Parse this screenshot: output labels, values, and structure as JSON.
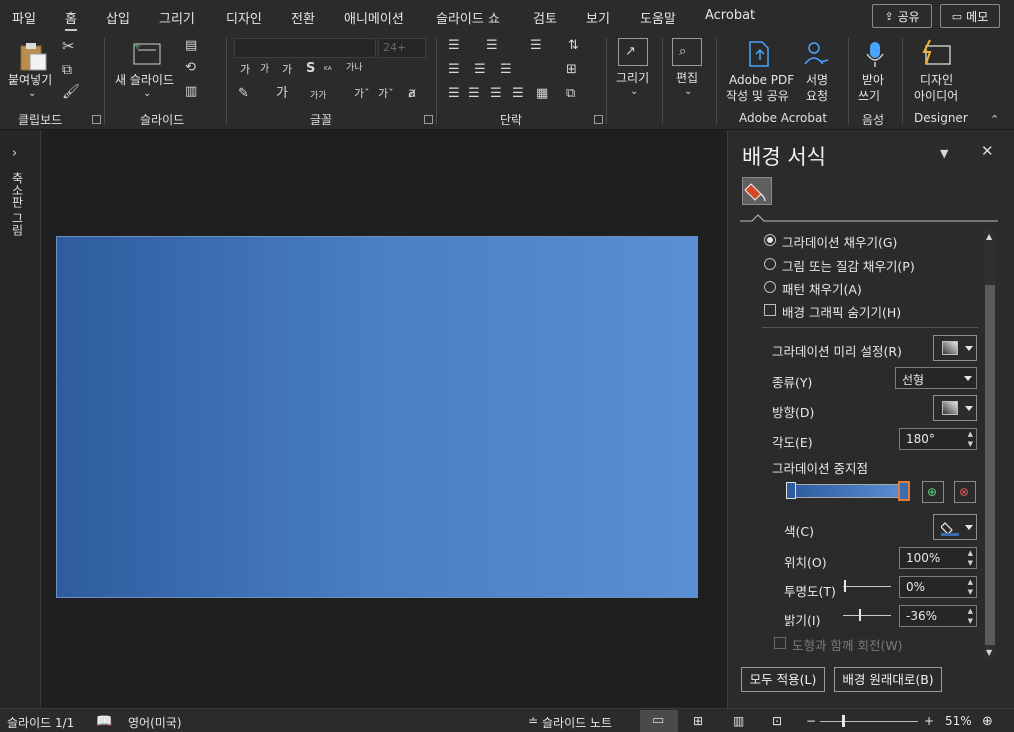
{
  "menu": {
    "tabs": [
      "파일",
      "홈",
      "삽입",
      "그리기",
      "디자인",
      "전환",
      "애니메이션",
      "슬라이드 쇼",
      "검토",
      "보기",
      "도움말",
      "Acrobat"
    ],
    "active_tab": "홈",
    "share_label": "공유",
    "memo_label": "메모"
  },
  "ribbon": {
    "clipboard": {
      "paste_label": "붙여넣기",
      "group_label": "클립보드"
    },
    "slides": {
      "new_slide_label": "새 슬라이드",
      "group_label": "슬라이드"
    },
    "font": {
      "group_label": "글꼴",
      "size_placeholder": "24+",
      "bold_s": "S",
      "glyph_ka1": "가",
      "glyph_ka2": "가",
      "glyph_ka3": "가",
      "glyph_kana": "가나",
      "glyph_kaka": "가가",
      "glyph_caret1": "가ˆ",
      "glyph_caret2": "가ˇ",
      "glyph_kaxx": "ᵏᵃ"
    },
    "paragraph": {
      "group_label": "단락"
    },
    "drawing": {
      "label": "그리기"
    },
    "editing": {
      "label": "편집"
    },
    "acrobat": {
      "pdf_label_1": "Adobe PDF",
      "pdf_label_2": "작성 및 공유",
      "sign_label_1": "서명",
      "sign_label_2": "요청",
      "group_label": "Adobe Acrobat"
    },
    "voice": {
      "dictate_label_1": "받아",
      "dictate_label_2": "쓰기",
      "group_label": "음성"
    },
    "designer": {
      "ideas_label_1": "디자인",
      "ideas_label_2": "아이디어",
      "group_label": "Designer"
    }
  },
  "left_strip": {
    "expand_label": "축소판 그림"
  },
  "pane": {
    "title": "배경 서식",
    "fill_options": [
      {
        "label": "그라데이션 채우기(G)",
        "selected": true
      },
      {
        "label": "그림 또는 질감 채우기(P)",
        "selected": false
      },
      {
        "label": "패턴 채우기(A)",
        "selected": false
      }
    ],
    "hide_bg_label": "배경 그래픽 숨기기(H)",
    "preset_label": "그라데이션 미리 설정(R)",
    "type_label": "종류(Y)",
    "type_value": "선형",
    "direction_label": "방향(D)",
    "angle_label": "각도(E)",
    "angle_value": "180°",
    "stops_label": "그라데이션 중지점",
    "color_label": "색(C)",
    "position_label": "위치(O)",
    "position_value": "100%",
    "transparency_label": "투명도(T)",
    "transparency_value": "0%",
    "brightness_label": "밝기(I)",
    "brightness_value": "-36%",
    "rotate_label": "도형과 함께 회전(W)",
    "apply_all_label": "모두 적용(L)",
    "reset_label": "배경 원래대로(B)"
  },
  "statusbar": {
    "slide_count": "슬라이드 1/1",
    "language": "영어(미국)",
    "notes_label": "슬라이드 노트",
    "zoom": "51%"
  },
  "colors": {
    "gradient_start": "#2e5c9e",
    "gradient_end": "#5b8fd4",
    "accent": "#c55a11"
  }
}
